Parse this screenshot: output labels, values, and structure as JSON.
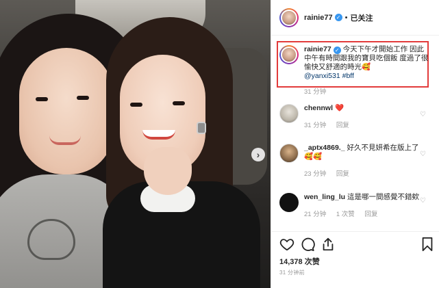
{
  "post": {
    "username": "rainie77",
    "follow_state": "已关注",
    "separator": "•",
    "caption_text": "今天下午才開始工作 因此中午有時間跟我的寶貝吃個飯 度過了很愉快又舒適的時光🥰",
    "caption_tags": "@yanxi531 #bff",
    "caption_time": "31 分钟",
    "likes": "14,378 次赞",
    "posted_time": "31 分钟前"
  },
  "comments": [
    {
      "username": "chennwl",
      "text": "❤️",
      "time": "31 分钟",
      "reply": "回复",
      "likes": ""
    },
    {
      "username": "_aptx4869._",
      "text": "好久不見妍希在版上了🥰🥰",
      "time": "23 分钟",
      "reply": "回复",
      "likes": ""
    },
    {
      "username": "wen_ling_lu",
      "text": "這是哪一間感覺不錯欸",
      "time": "21 分钟",
      "reply": "回复",
      "likes": "1 次赞"
    }
  ],
  "icons": {
    "like": "heart-icon",
    "comment": "comment-icon",
    "share": "share-icon",
    "save": "bookmark-icon",
    "next": "chevron-right-icon"
  },
  "colors": {
    "accent": "#3897f0",
    "highlight_border": "#e23a3a",
    "heart_red": "#ed4956"
  }
}
